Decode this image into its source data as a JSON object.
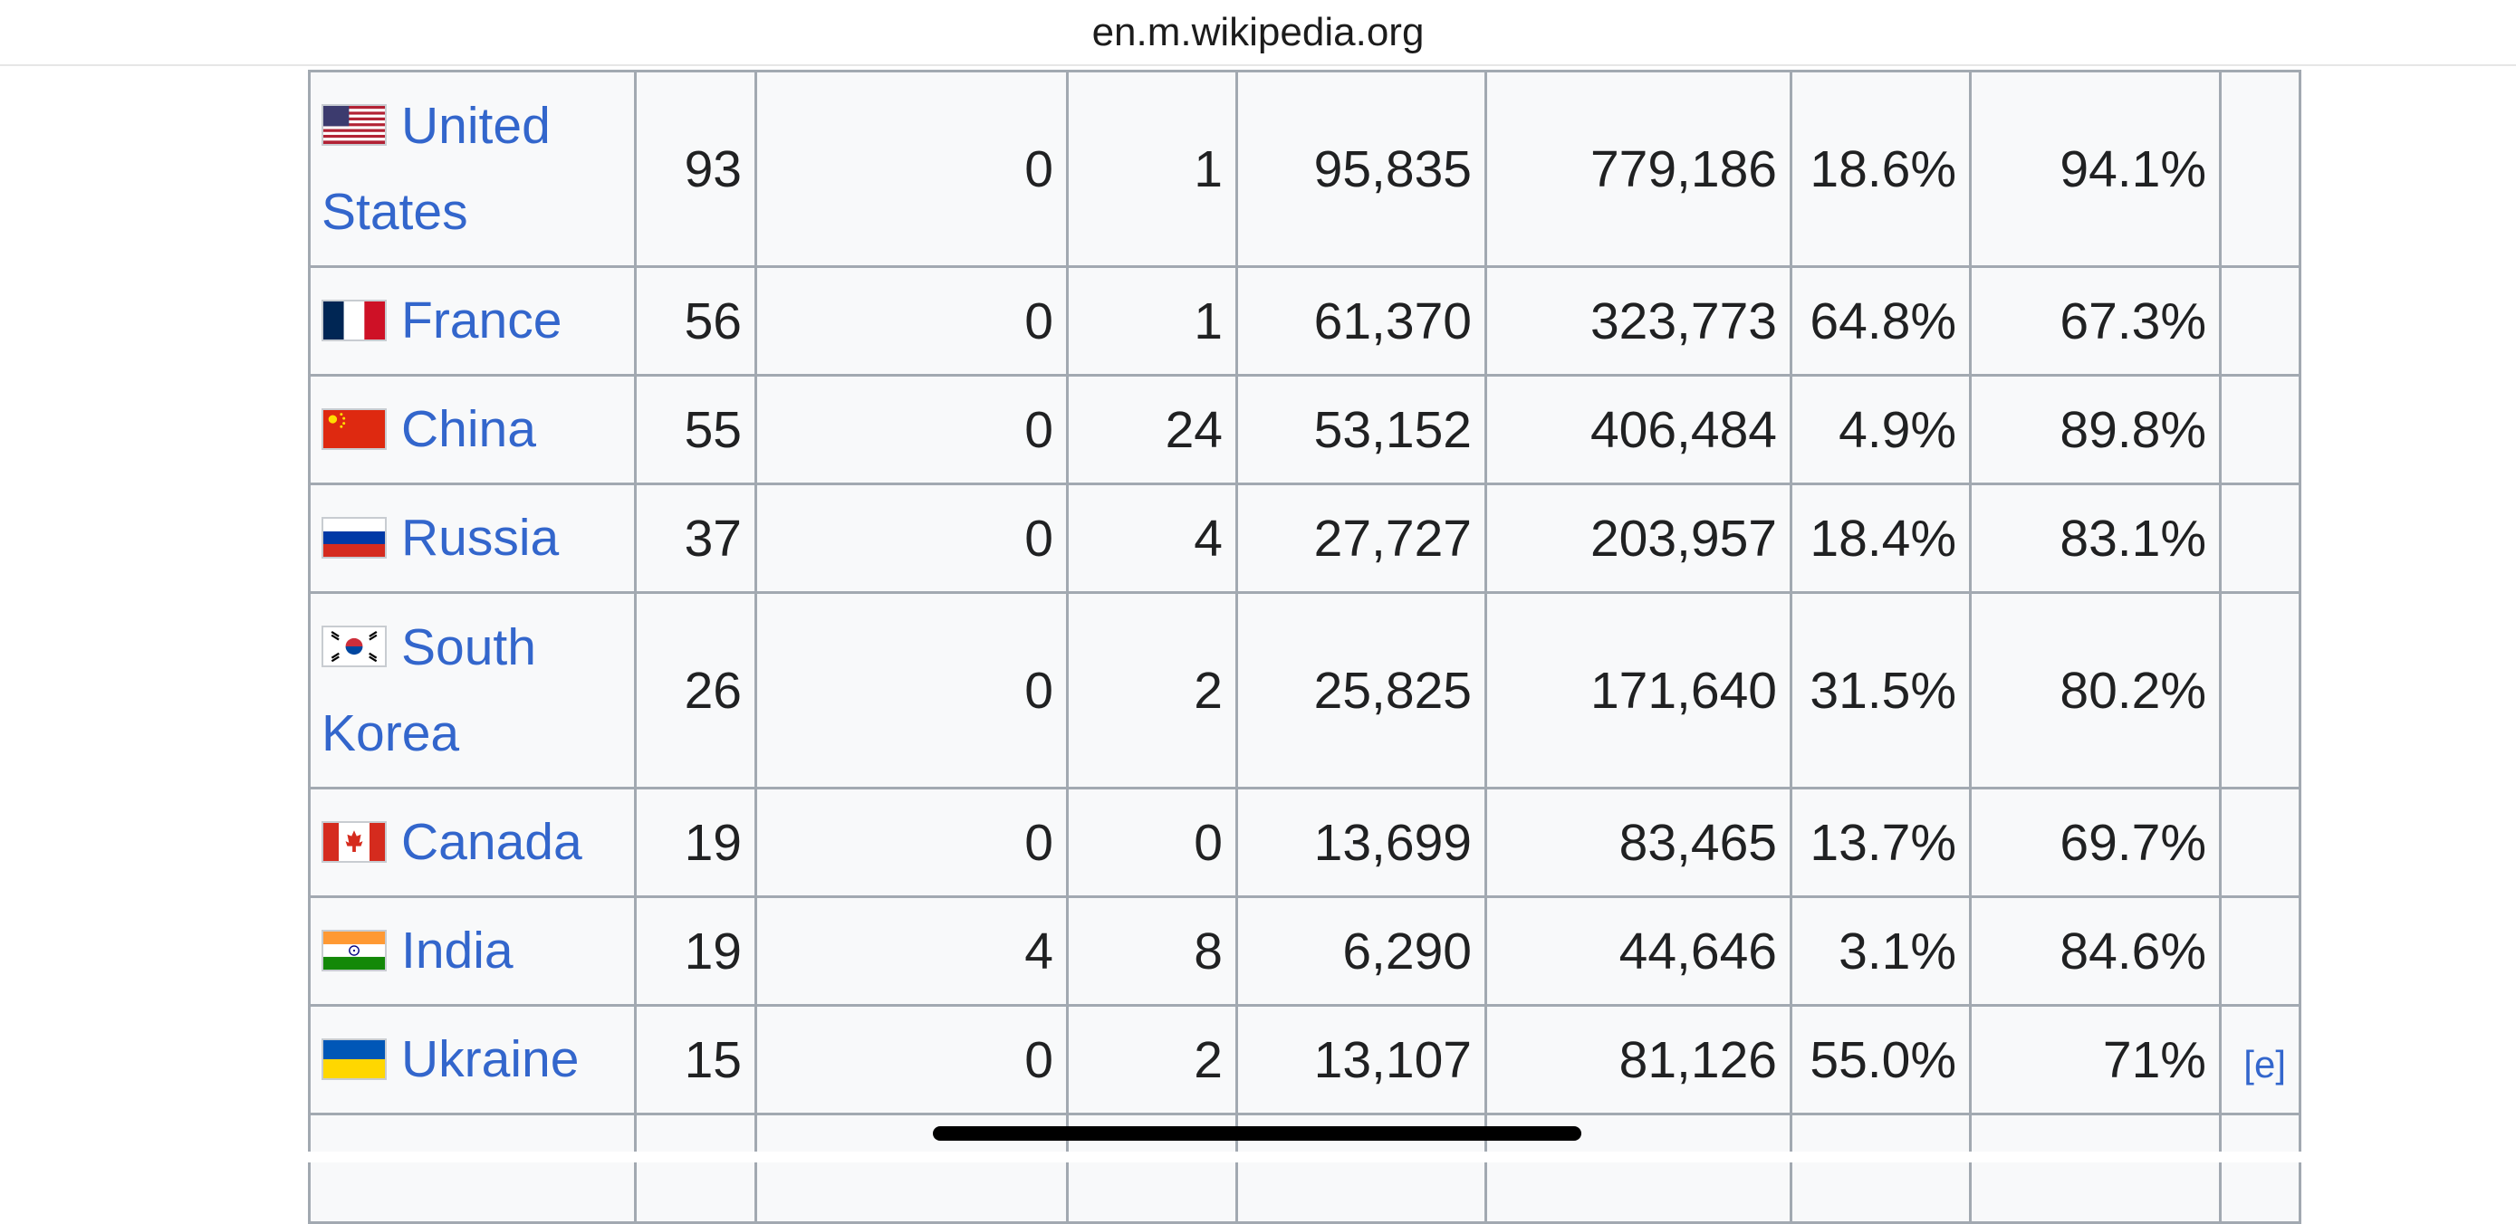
{
  "browser": {
    "url": "en.m.wikipedia.org"
  },
  "table": {
    "rows": [
      {
        "flag": "us-flag-icon",
        "country": "United States",
        "c1": "93",
        "c2": "0",
        "c3": "1",
        "c4": "95,835",
        "c5": "779,186",
        "c6": "18.6%",
        "c7": "94.1%",
        "note": ""
      },
      {
        "flag": "france-flag-icon",
        "country": "France",
        "c1": "56",
        "c2": "0",
        "c3": "1",
        "c4": "61,370",
        "c5": "323,773",
        "c6": "64.8%",
        "c7": "67.3%",
        "note": ""
      },
      {
        "flag": "china-flag-icon",
        "country": "China",
        "c1": "55",
        "c2": "0",
        "c3": "24",
        "c4": "53,152",
        "c5": "406,484",
        "c6": "4.9%",
        "c7": "89.8%",
        "note": ""
      },
      {
        "flag": "russia-flag-icon",
        "country": "Russia",
        "c1": "37",
        "c2": "0",
        "c3": "4",
        "c4": "27,727",
        "c5": "203,957",
        "c6": "18.4%",
        "c7": "83.1%",
        "note": ""
      },
      {
        "flag": "south-korea-flag-icon",
        "country": "South Korea",
        "c1": "26",
        "c2": "0",
        "c3": "2",
        "c4": "25,825",
        "c5": "171,640",
        "c6": "31.5%",
        "c7": "80.2%",
        "note": ""
      },
      {
        "flag": "canada-flag-icon",
        "country": "Canada",
        "c1": "19",
        "c2": "0",
        "c3": "0",
        "c4": "13,699",
        "c5": "83,465",
        "c6": "13.7%",
        "c7": "69.7%",
        "note": ""
      },
      {
        "flag": "india-flag-icon",
        "country": "India",
        "c1": "19",
        "c2": "4",
        "c3": "8",
        "c4": "6,290",
        "c5": "44,646",
        "c6": "3.1%",
        "c7": "84.6%",
        "note": ""
      },
      {
        "flag": "ukraine-flag-icon",
        "country": "Ukraine",
        "c1": "15",
        "c2": "0",
        "c3": "2",
        "c4": "13,107",
        "c5": "81,126",
        "c6": "55.0%",
        "c7": "71%",
        "note": "[e]"
      }
    ]
  },
  "colors": {
    "link": "#3366cc",
    "text": "#202122",
    "table_bg": "#f8f9fa",
    "border": "#a2a9b1"
  }
}
